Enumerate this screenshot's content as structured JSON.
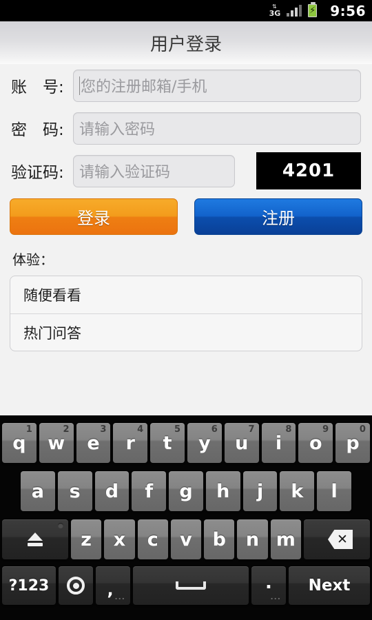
{
  "statusbar": {
    "network": "3G",
    "network_arrows": "↕",
    "clock": "9:56",
    "icons": [
      "3g-icon",
      "signal-icon",
      "battery-charging-icon"
    ]
  },
  "titlebar": {
    "title": "用户登录"
  },
  "form": {
    "account": {
      "label": "账　号:",
      "placeholder": "您的注册邮箱/手机",
      "value": ""
    },
    "password": {
      "label": "密　码:",
      "placeholder": "请输入密码",
      "value": ""
    },
    "captcha": {
      "label": "验证码:",
      "placeholder": "请输入验证码",
      "value": "",
      "code": "4201"
    }
  },
  "buttons": {
    "login": "登录",
    "register": "注册",
    "login_color": "#f0921a",
    "register_color": "#1060c6"
  },
  "experience": {
    "label": "体验：",
    "items": [
      {
        "label": "随便看看"
      },
      {
        "label": "热门问答"
      }
    ]
  },
  "keyboard": {
    "row1": [
      {
        "key": "q",
        "hint": "1"
      },
      {
        "key": "w",
        "hint": "2"
      },
      {
        "key": "e",
        "hint": "3"
      },
      {
        "key": "r",
        "hint": "4"
      },
      {
        "key": "t",
        "hint": "5"
      },
      {
        "key": "y",
        "hint": "6"
      },
      {
        "key": "u",
        "hint": "7"
      },
      {
        "key": "i",
        "hint": "8"
      },
      {
        "key": "o",
        "hint": "9"
      },
      {
        "key": "p",
        "hint": "0"
      }
    ],
    "row2": [
      {
        "key": "a"
      },
      {
        "key": "s"
      },
      {
        "key": "d"
      },
      {
        "key": "f"
      },
      {
        "key": "g"
      },
      {
        "key": "h"
      },
      {
        "key": "j"
      },
      {
        "key": "k"
      },
      {
        "key": "l"
      }
    ],
    "row3": [
      {
        "key": "z"
      },
      {
        "key": "x"
      },
      {
        "key": "c"
      },
      {
        "key": "v"
      },
      {
        "key": "b"
      },
      {
        "key": "n"
      },
      {
        "key": "m"
      }
    ],
    "shift_name": "shift-key",
    "backspace_name": "backspace-key",
    "num_symbol": "?123",
    "comma": ",",
    "period": ".",
    "dots": "...",
    "enter": "Next"
  }
}
